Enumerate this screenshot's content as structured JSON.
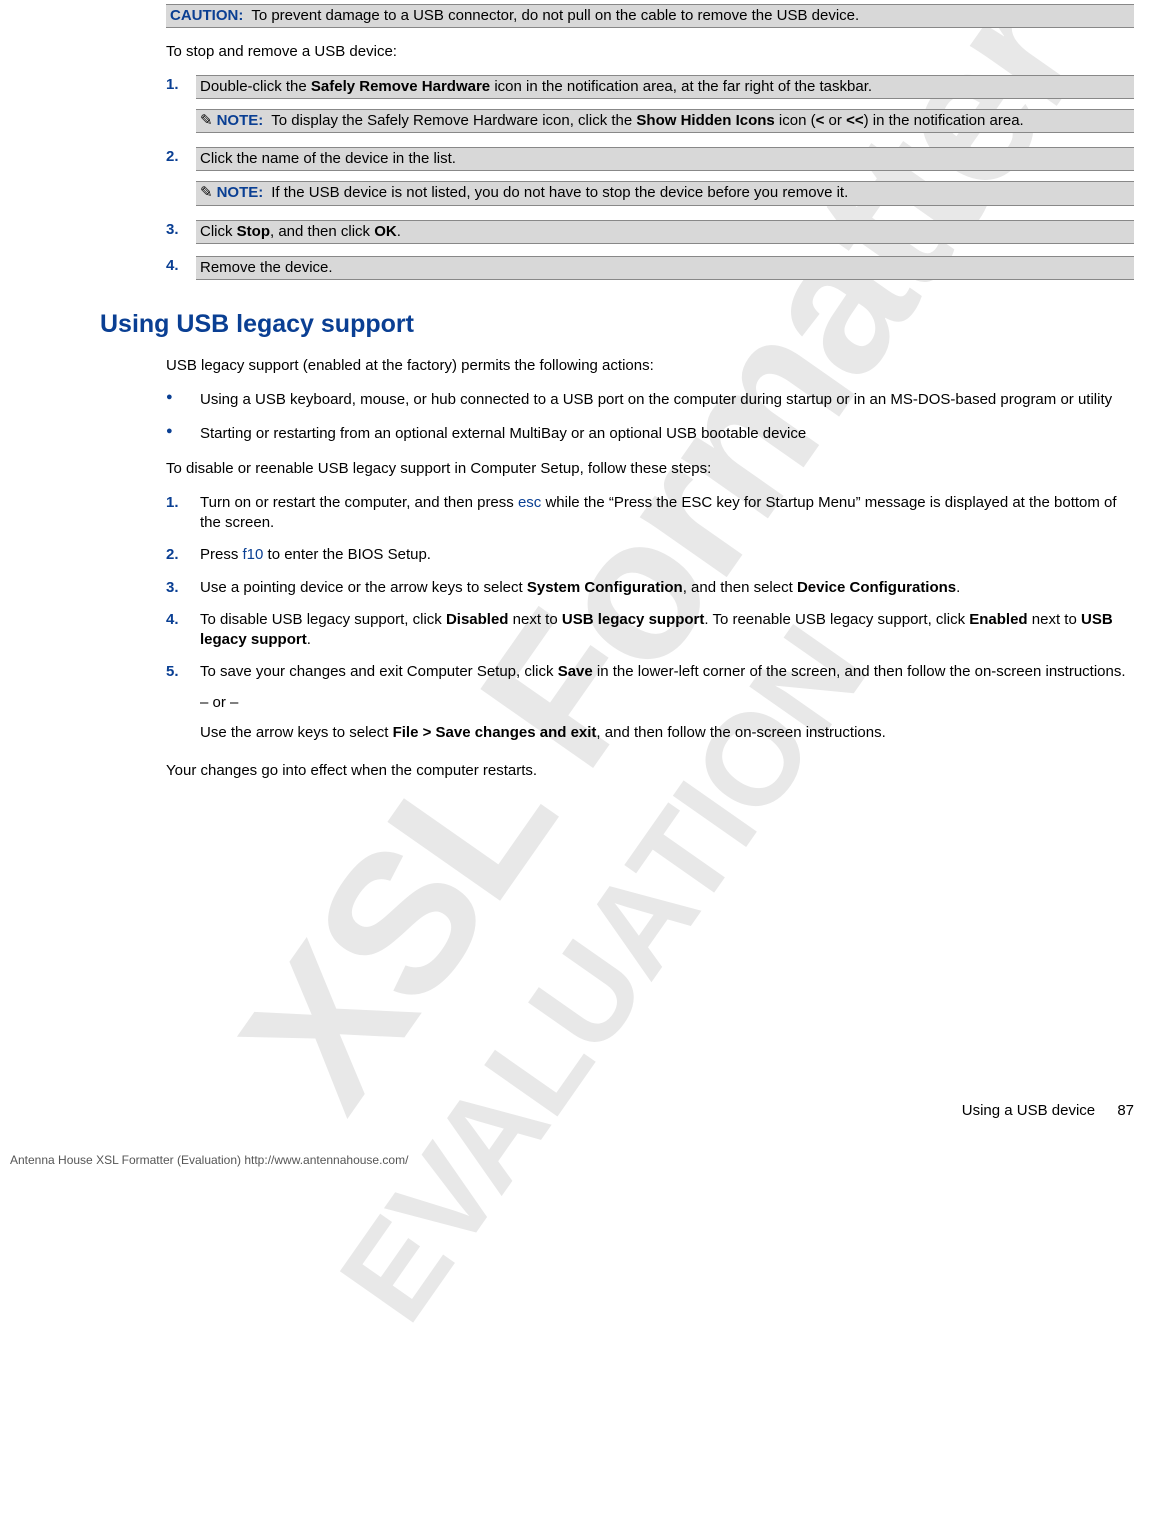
{
  "watermark": {
    "line1": "XSL Formatter",
    "line2": "EVALUATION"
  },
  "caution": {
    "label": "CAUTION:",
    "text_a": "To prevent damage to a USB connector, do not pull on the cable to remove the USB device."
  },
  "stop_intro": "To stop and remove a USB device:",
  "steps1": {
    "s1_a": "Double-click the ",
    "s1_b": "Safely Remove Hardware",
    "s1_c": " icon in the notification area, at the far right of the taskbar.",
    "note1_label": "NOTE:",
    "note1_a": "To display the Safely Remove Hardware icon, click the ",
    "note1_b": "Show Hidden Icons",
    "note1_c": " icon (",
    "note1_d": "<",
    "note1_e": " or ",
    "note1_f": "<<",
    "note1_g": ") in the notification area.",
    "s2": "Click the name of the device in the list.",
    "note2_label": "NOTE:",
    "note2": "If the USB device is not listed, you do not have to stop the device before you remove it.",
    "s3_a": "Click ",
    "s3_b": "Stop",
    "s3_c": ", and then click ",
    "s3_d": "OK",
    "s3_e": ".",
    "s4": "Remove the device."
  },
  "section_head": "Using USB legacy support",
  "legacy_intro": "USB legacy support (enabled at the factory) permits the following actions:",
  "bullets": {
    "b1": "Using a USB keyboard, mouse, or hub connected to a USB port on the computer during startup or in an MS-DOS-based program or utility",
    "b2": "Starting or restarting from an optional external MultiBay or an optional USB bootable device"
  },
  "disable_intro": "To disable or reenable USB legacy support in Computer Setup, follow these steps:",
  "steps2": {
    "s1_a": "Turn on or restart the computer, and then press ",
    "s1_b": "esc",
    "s1_c": " while the “Press the ESC key for Startup Menu” message is displayed at the bottom of the screen.",
    "s2_a": "Press ",
    "s2_b": "f10",
    "s2_c": " to enter the BIOS Setup.",
    "s3_a": "Use a pointing device or the arrow keys to select ",
    "s3_b": "System Configuration",
    "s3_c": ", and then select ",
    "s3_d": "Device Configurations",
    "s3_e": ".",
    "s4_a": "To disable USB legacy support, click ",
    "s4_b": "Disabled",
    "s4_c": " next to ",
    "s4_d": "USB legacy support",
    "s4_e": ". To reenable USB legacy support, click ",
    "s4_f": "Enabled",
    "s4_g": " next to ",
    "s4_h": "USB legacy support",
    "s4_i": ".",
    "s5_a": "To save your changes and exit Computer Setup, click ",
    "s5_b": "Save",
    "s5_c": " in the lower-left corner of the screen, and then follow the on-screen instructions.",
    "s5_or": "– or –",
    "s5_d": "Use the arrow keys to select ",
    "s5_e": "File > Save changes and exit",
    "s5_f": ", and then follow the on-screen instructions."
  },
  "closing": "Your changes go into effect when the computer restarts.",
  "footer": {
    "section": "Using a USB device",
    "pagenum": "87",
    "generator": "Antenna House XSL Formatter (Evaluation)  http://www.antennahouse.com/"
  }
}
